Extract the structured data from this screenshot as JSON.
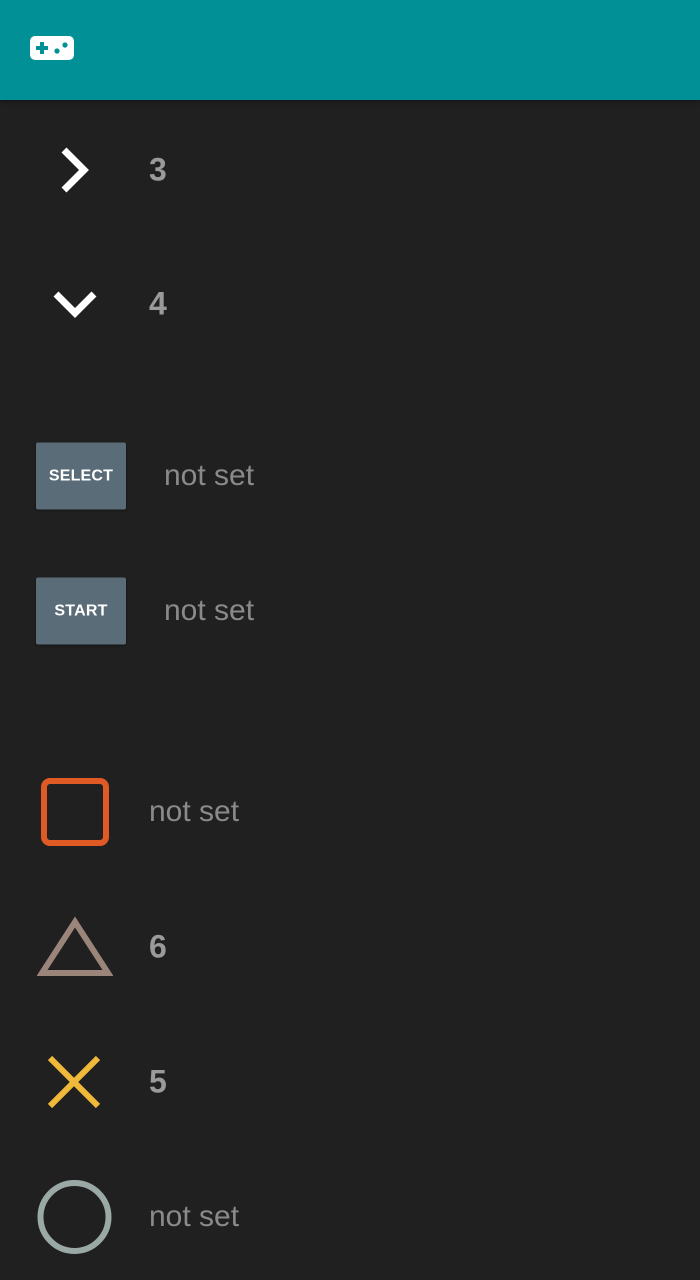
{
  "header": {
    "icon": "gamepad-icon",
    "color": "#009095"
  },
  "mappings": [
    {
      "control": "dpad-right",
      "icon": "chevron-right-icon",
      "value": "3"
    },
    {
      "control": "dpad-down",
      "icon": "chevron-down-icon",
      "value": "4"
    },
    {
      "control": "select",
      "icon": "select-button-icon",
      "button_label": "SELECT",
      "value": "not set"
    },
    {
      "control": "start",
      "icon": "start-button-icon",
      "button_label": "START",
      "value": "not set"
    },
    {
      "control": "square",
      "icon": "square-icon",
      "value": "not set",
      "color": "#e05a26"
    },
    {
      "control": "triangle",
      "icon": "triangle-icon",
      "value": "6",
      "color": "#9b857a"
    },
    {
      "control": "cross",
      "icon": "cross-icon",
      "value": "5",
      "color": "#f0b93a"
    },
    {
      "control": "circle",
      "icon": "circle-icon",
      "value": "not set",
      "color": "#9aa8a6"
    }
  ]
}
